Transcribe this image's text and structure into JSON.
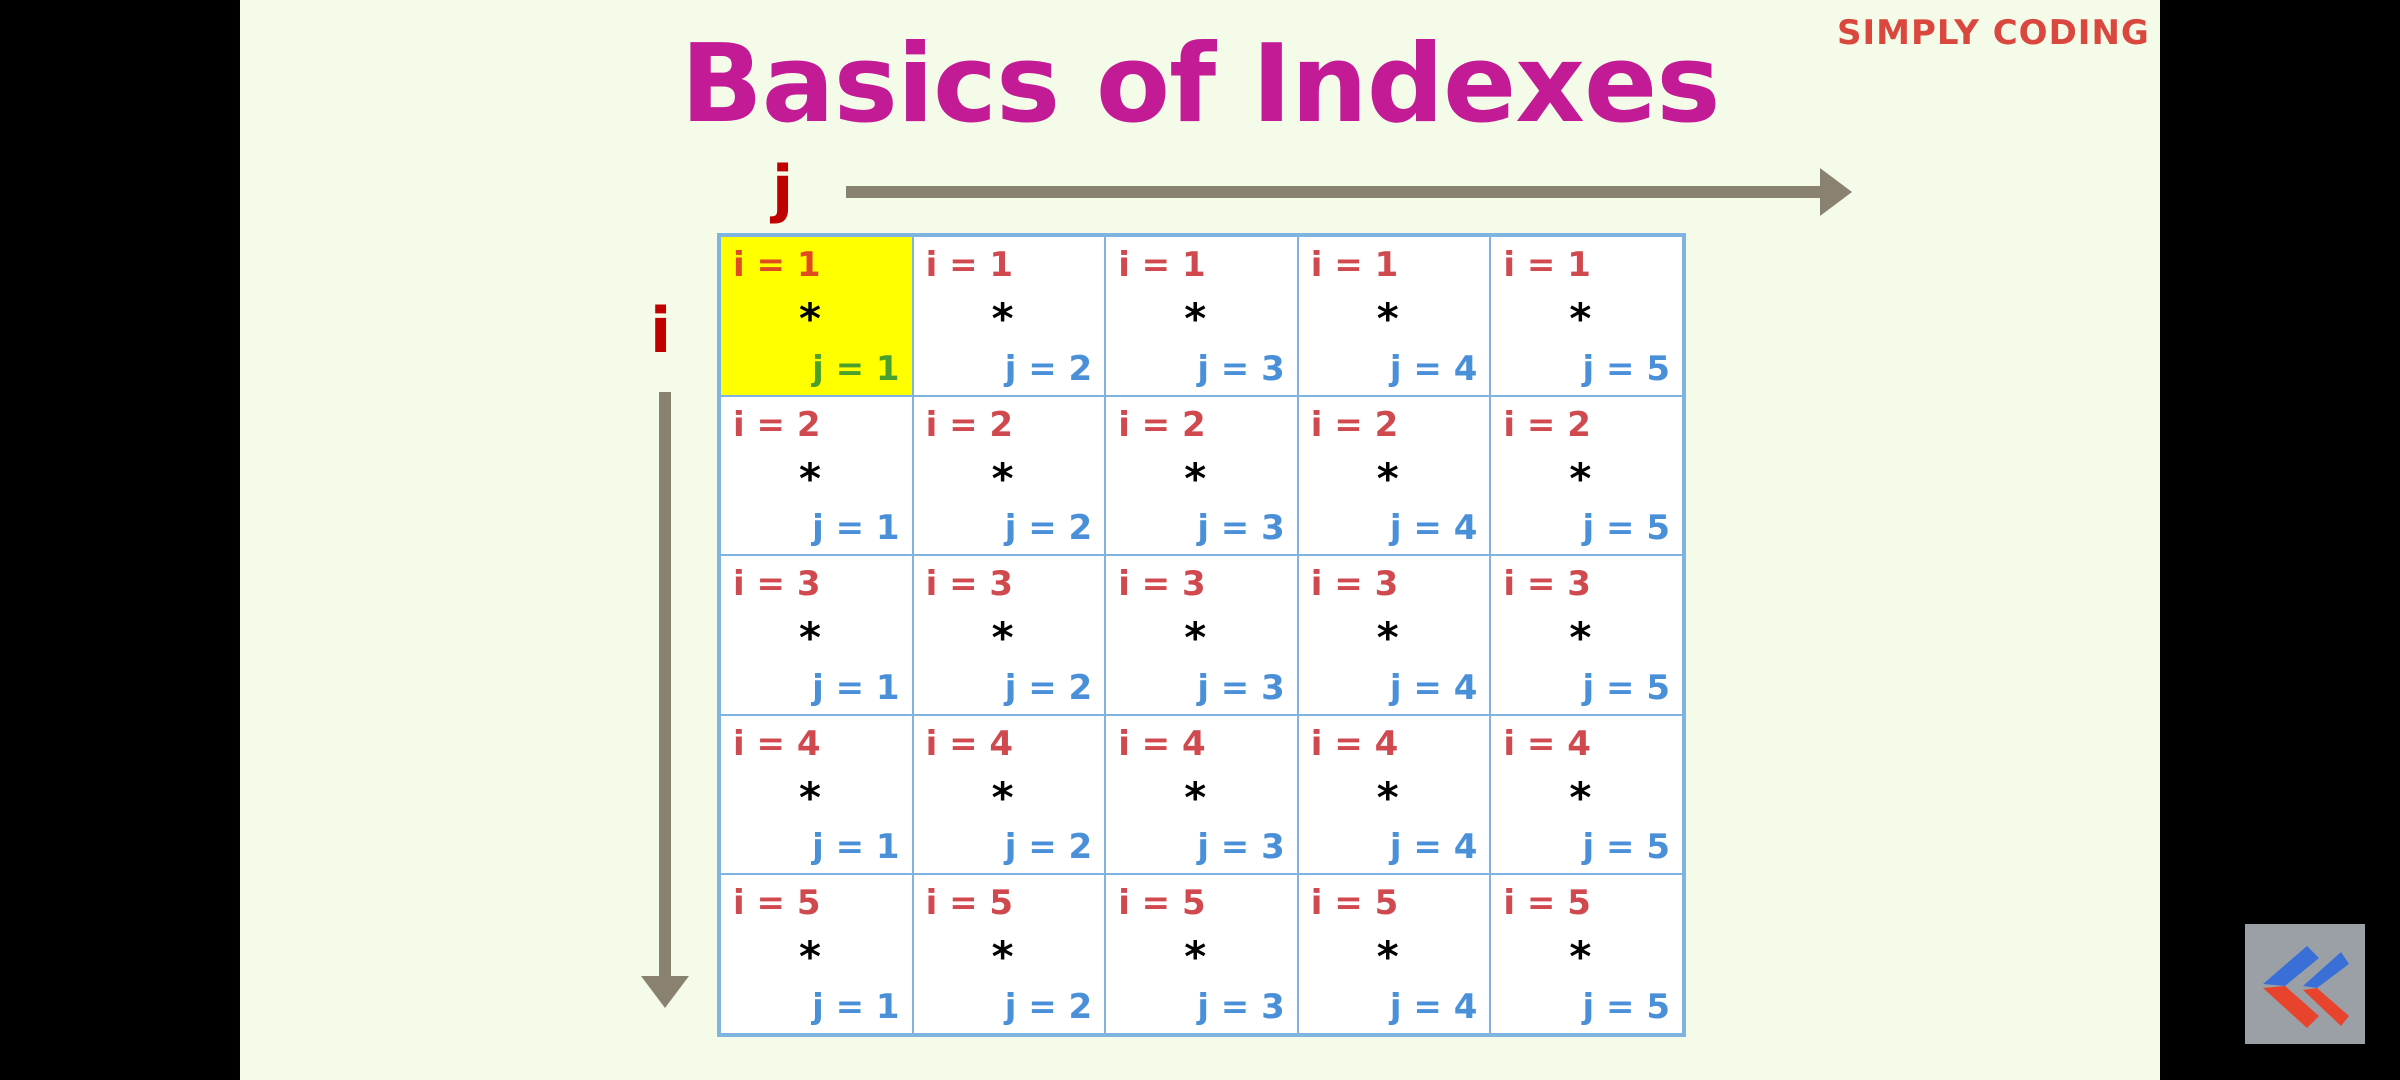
{
  "title": "Basics of Indexes",
  "brand": "SIMPLY CODING",
  "axis": {
    "j_label": "j",
    "i_label": "i"
  },
  "grid": {
    "rows": [
      [
        {
          "i": "i = 1",
          "star": "*",
          "j": "j = 1",
          "highlight": true
        },
        {
          "i": "i = 1",
          "star": "*",
          "j": "j = 2"
        },
        {
          "i": "i = 1",
          "star": "*",
          "j": "j = 3"
        },
        {
          "i": "i = 1",
          "star": "*",
          "j": "j = 4"
        },
        {
          "i": "i = 1",
          "star": "*",
          "j": "j = 5"
        }
      ],
      [
        {
          "i": "i = 2",
          "star": "*",
          "j": "j = 1"
        },
        {
          "i": "i = 2",
          "star": "*",
          "j": "j = 2"
        },
        {
          "i": "i = 2",
          "star": "*",
          "j": "j = 3"
        },
        {
          "i": "i = 2",
          "star": "*",
          "j": "j = 4"
        },
        {
          "i": "i = 2",
          "star": "*",
          "j": "j = 5"
        }
      ],
      [
        {
          "i": "i = 3",
          "star": "*",
          "j": "j = 1"
        },
        {
          "i": "i = 3",
          "star": "*",
          "j": "j = 2"
        },
        {
          "i": "i = 3",
          "star": "*",
          "j": "j = 3"
        },
        {
          "i": "i = 3",
          "star": "*",
          "j": "j = 4"
        },
        {
          "i": "i = 3",
          "star": "*",
          "j": "j = 5"
        }
      ],
      [
        {
          "i": "i = 4",
          "star": "*",
          "j": "j = 1"
        },
        {
          "i": "i = 4",
          "star": "*",
          "j": "j = 2"
        },
        {
          "i": "i = 4",
          "star": "*",
          "j": "j = 3"
        },
        {
          "i": "i = 4",
          "star": "*",
          "j": "j = 4"
        },
        {
          "i": "i = 4",
          "star": "*",
          "j": "j = 5"
        }
      ],
      [
        {
          "i": "i = 5",
          "star": "*",
          "j": "j = 1"
        },
        {
          "i": "i = 5",
          "star": "*",
          "j": "j = 2"
        },
        {
          "i": "i = 5",
          "star": "*",
          "j": "j = 3"
        },
        {
          "i": "i = 5",
          "star": "*",
          "j": "j = 4"
        },
        {
          "i": "i = 5",
          "star": "*",
          "j": "j = 5"
        }
      ]
    ]
  },
  "colors": {
    "title": "#c21b95",
    "axis_label": "#c00000",
    "arrow": "#8a8270",
    "i_text": "#d0494f",
    "j_text": "#4a90d9",
    "highlight": "#ffff00",
    "grid_border": "#7fb4e0"
  },
  "icons": {
    "corner": "simply-coding-logo-icon"
  }
}
